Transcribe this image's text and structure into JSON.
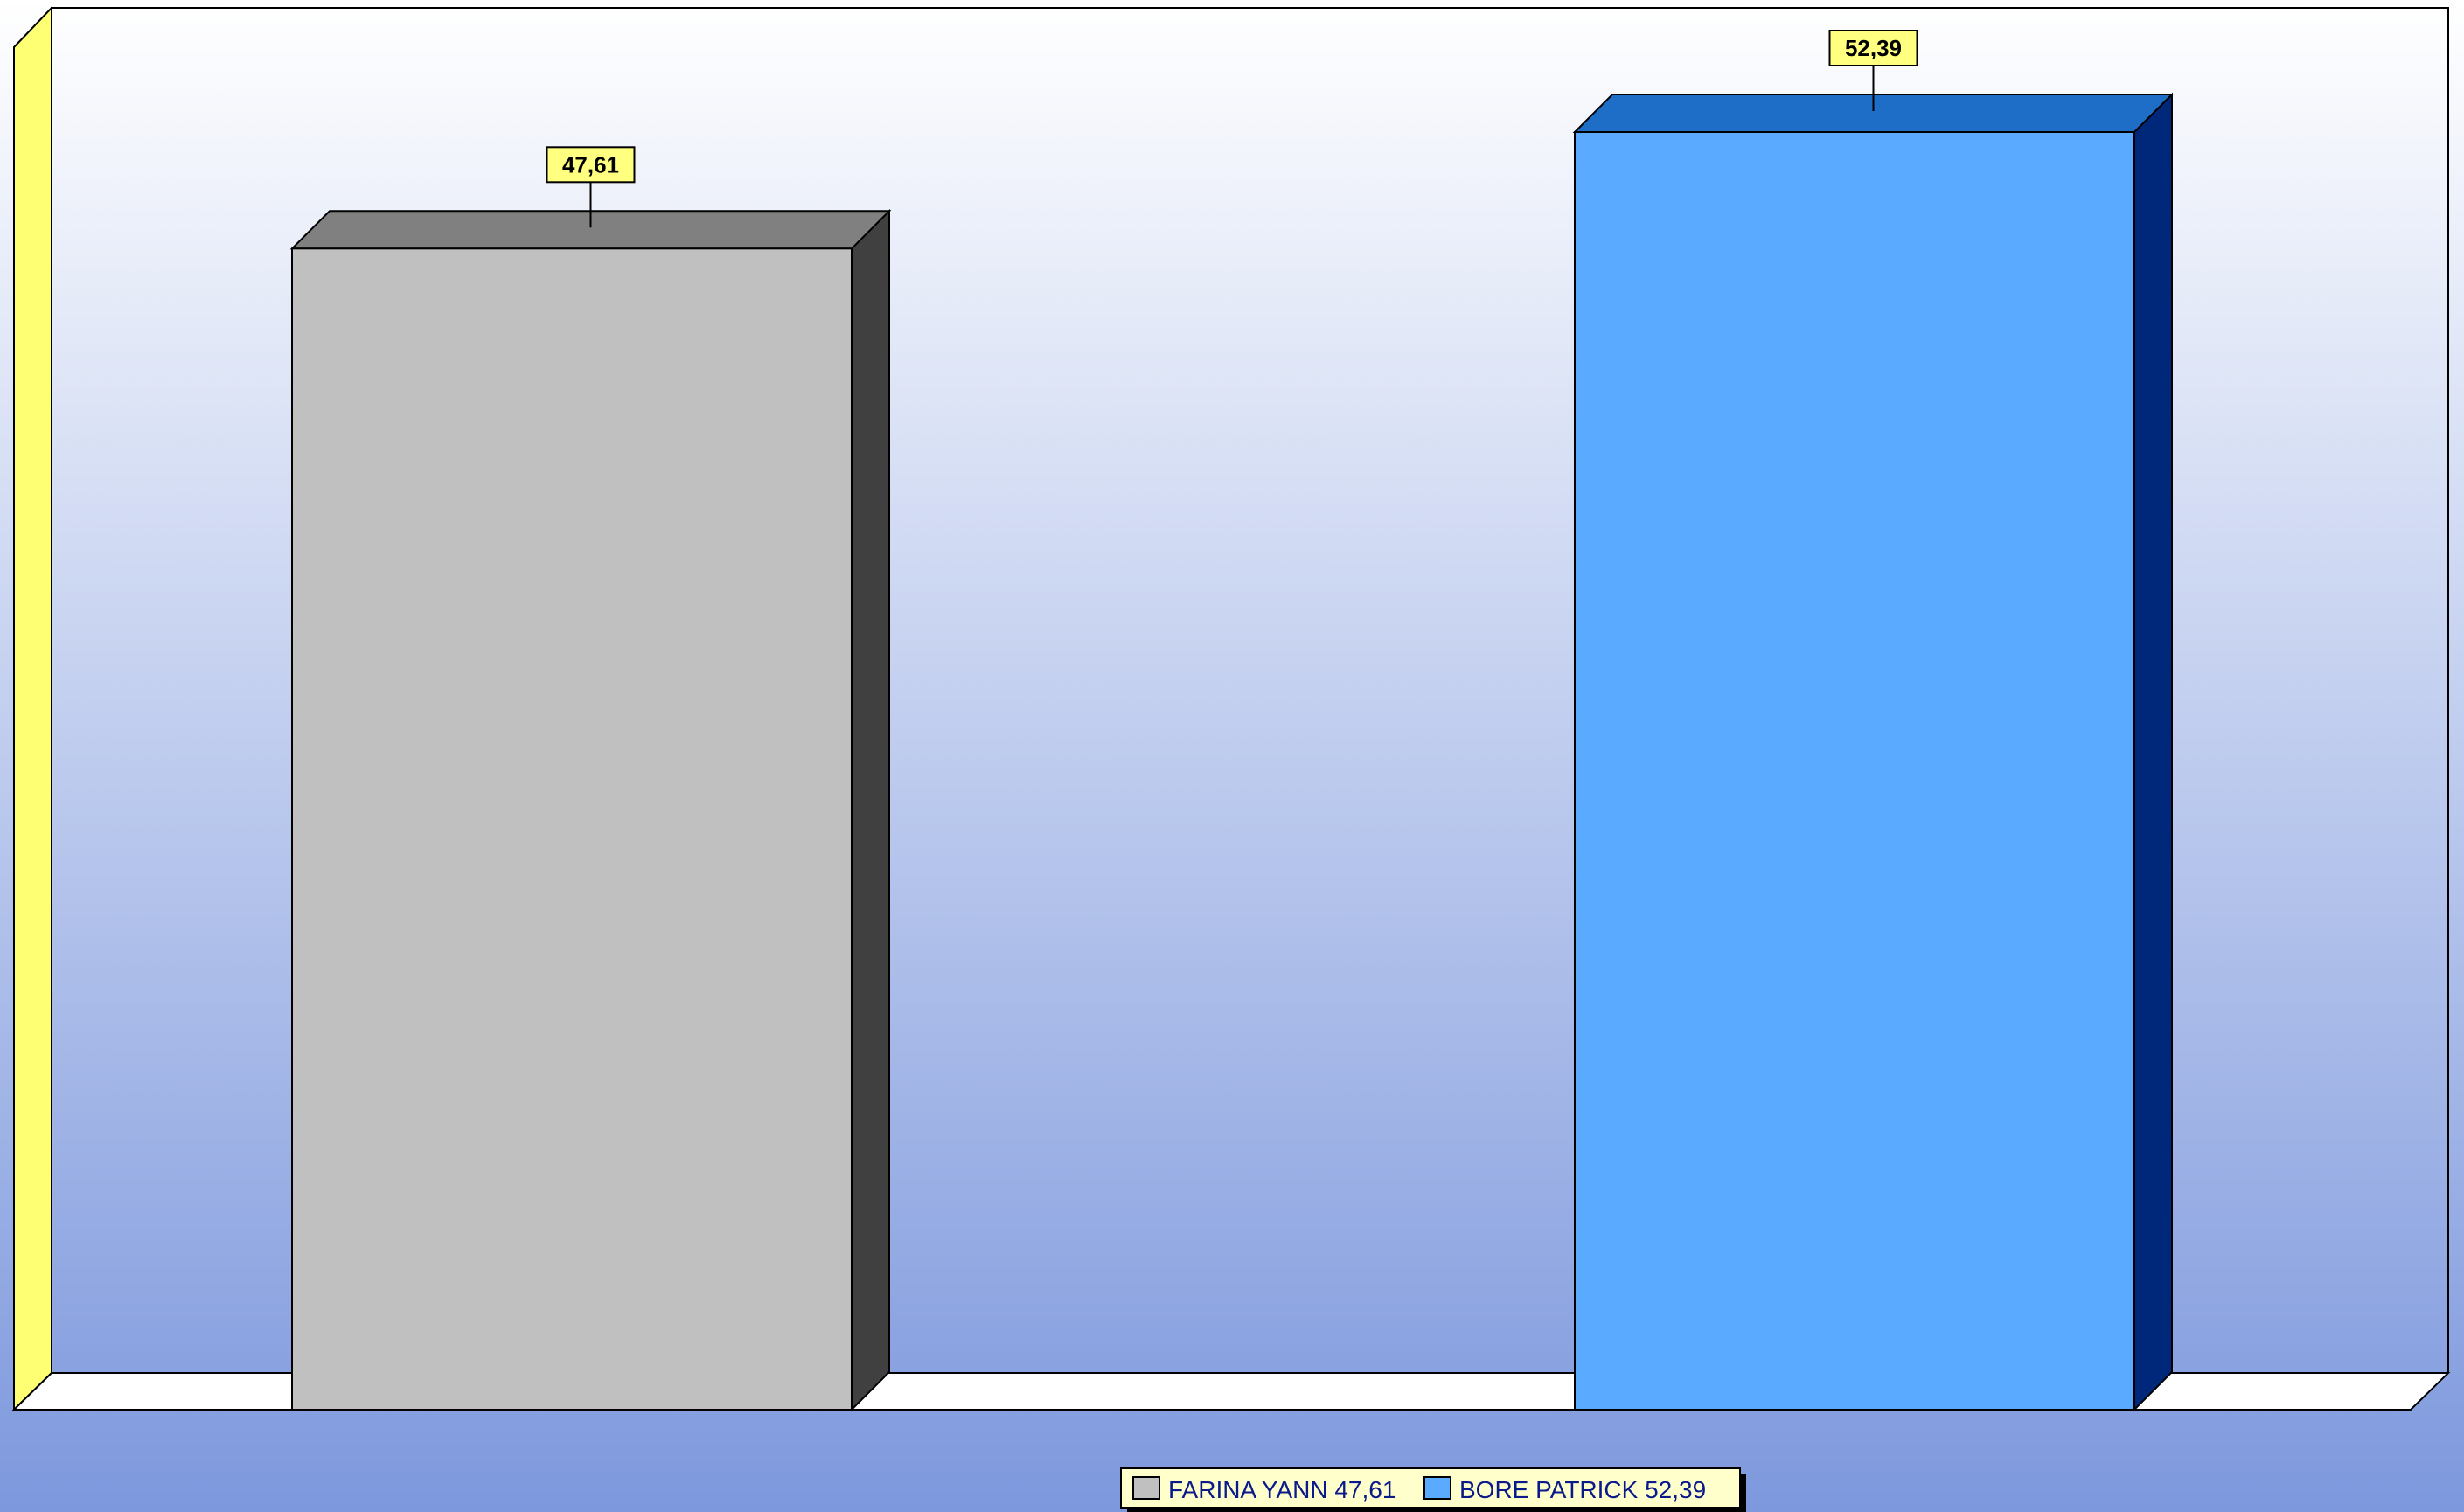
{
  "chart_data": {
    "type": "bar",
    "style": "3d",
    "categories": [
      "FARINA YANN",
      "BORE PATRICK"
    ],
    "values": [
      47.61,
      52.39
    ],
    "data_labels": [
      "47,61",
      "52,39"
    ],
    "ylim": [
      0,
      52.39
    ],
    "grid": false,
    "legend": {
      "placement": "bottom-center",
      "entries": [
        "FARINA YANN 47,61",
        "BORE PATRICK 52,39"
      ]
    },
    "title": "",
    "xlabel": "",
    "ylabel": ""
  },
  "colors": {
    "background_top": "#ffffff",
    "background_bottom": "#7d98dd",
    "left_wall": "#ffff73",
    "floor": "#ffffff",
    "label_box": "#ffff80",
    "legend_box": "#ffffcc",
    "bars": [
      {
        "front": "#c0c0c0",
        "top": "#808080",
        "side": "#404040"
      },
      {
        "front": "#5aaaff",
        "top": "#1e6ec8",
        "side": "#00287a"
      }
    ]
  }
}
